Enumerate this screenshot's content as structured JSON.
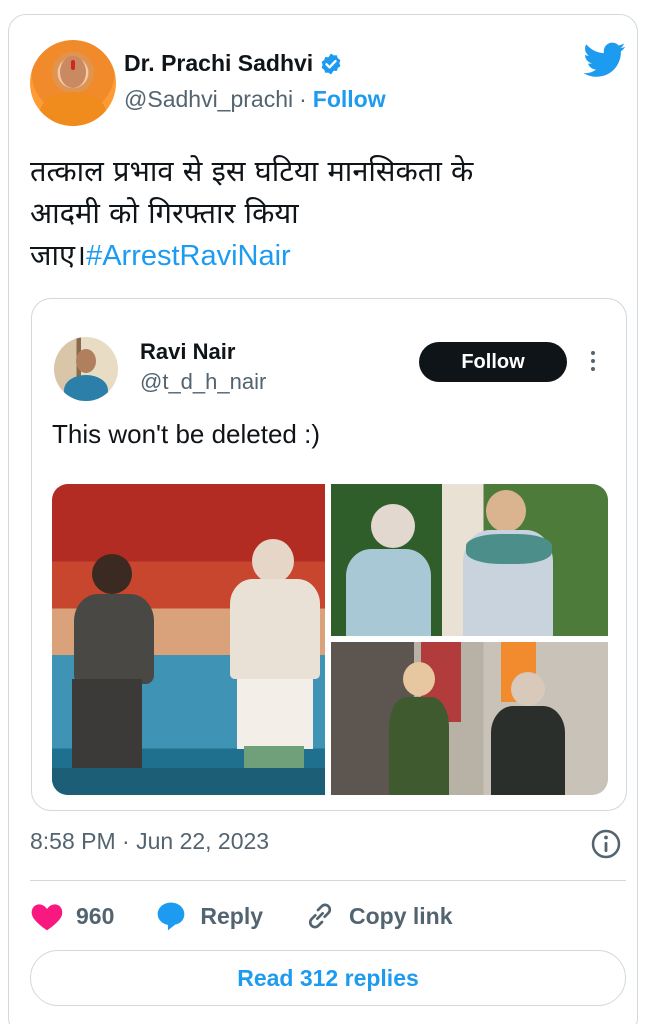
{
  "author": {
    "display_name": "Dr. Prachi Sadhvi",
    "handle": "@Sadhvi_prachi",
    "separator": "·",
    "follow_label": "Follow"
  },
  "tweet": {
    "text_line1": "तत्काल प्रभाव से इस घटिया मानसिकता के",
    "text_line2": "आदमी को गिरफ्तार किया",
    "text_line3": "जाए।",
    "hashtag": "#ArrestRaviNair"
  },
  "quoted": {
    "display_name": "Ravi Nair",
    "handle": "@t_d_h_nair",
    "follow_label": "Follow",
    "text": "This won't be deleted :)"
  },
  "footer": {
    "timestamp": "8:58 PM · Jun 22, 2023",
    "likes_count": "960",
    "reply_label": "Reply",
    "copy_link_label": "Copy link",
    "read_replies_label": "Read 312 replies"
  },
  "colors": {
    "accent": "#1d9bf0",
    "like": "#f91880",
    "text": "#0f1419",
    "muted": "#536471"
  },
  "icons": [
    "twitter-bird-icon",
    "verified-badge-icon",
    "more-icon",
    "info-icon",
    "heart-icon",
    "reply-bubble-icon",
    "link-icon"
  ]
}
